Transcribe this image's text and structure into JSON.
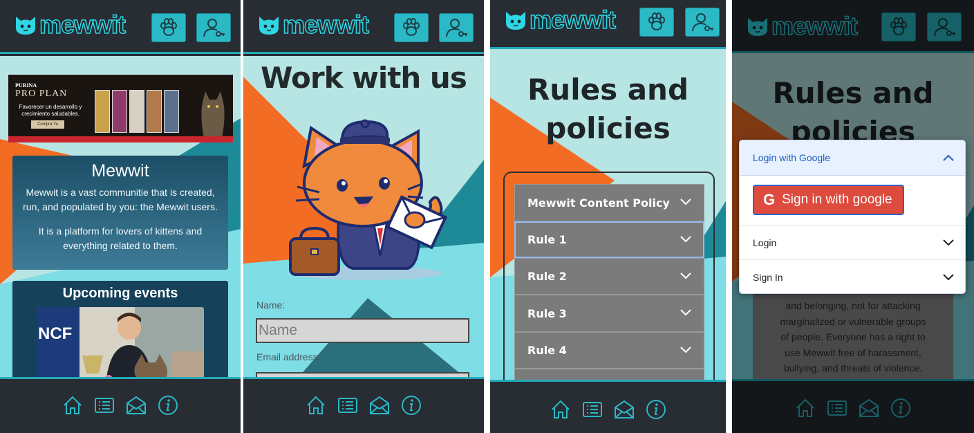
{
  "app": {
    "brand": "mewwit"
  },
  "colors": {
    "accent": "#2bb9c6",
    "header_bg": "#282c33",
    "light_bg": "#b6e5e3",
    "orange": "#f26c24",
    "teal_dark": "#1f8a97"
  },
  "header": {
    "paw_button_icon": "paw-icon",
    "user_button_icon": "user-key-icon"
  },
  "footer": {
    "icons": [
      "home-icon",
      "list-icon",
      "mail-icon",
      "info-icon"
    ]
  },
  "panel1": {
    "ad": {
      "brand_top": "PURINA",
      "brand_name": "PRO PLAN",
      "tagline": "Favorecer un desarrollo y crecimiento saludables.",
      "cta": "Compra Ya"
    },
    "about": {
      "title": "Mewwit",
      "p1": "Mewwit is a vast communitie that is created, run, and populated by you: the Mewwit users.",
      "p2": "It is a platform for lovers of kittens and everything related to them."
    },
    "events": {
      "title": "Upcoming events",
      "image_text": "NCF"
    }
  },
  "panel2": {
    "title": "Work with us",
    "name_label": "Name:",
    "name_placeholder": "Name",
    "email_label": "Email address:"
  },
  "panel3": {
    "title_line1": "Rules and",
    "title_line2": "policies",
    "accordion": [
      "Mewwit Content Policy",
      "Rule 1",
      "Rule 2",
      "Rule 3",
      "Rule 4"
    ]
  },
  "panel4": {
    "title_line1": "Rules and",
    "title_line2": "policies",
    "bg_text_lines": [
      "and belonging, not for attacking",
      "marginalized or vulnerable groups",
      "of people. Everyone has a right to",
      "use Mewwit free of harassment,",
      "bullying, and threats of violence."
    ],
    "modal": {
      "section1": "Login with Google",
      "google_button": "Sign in with google",
      "section2": "Login",
      "section3": "Sign In"
    }
  }
}
